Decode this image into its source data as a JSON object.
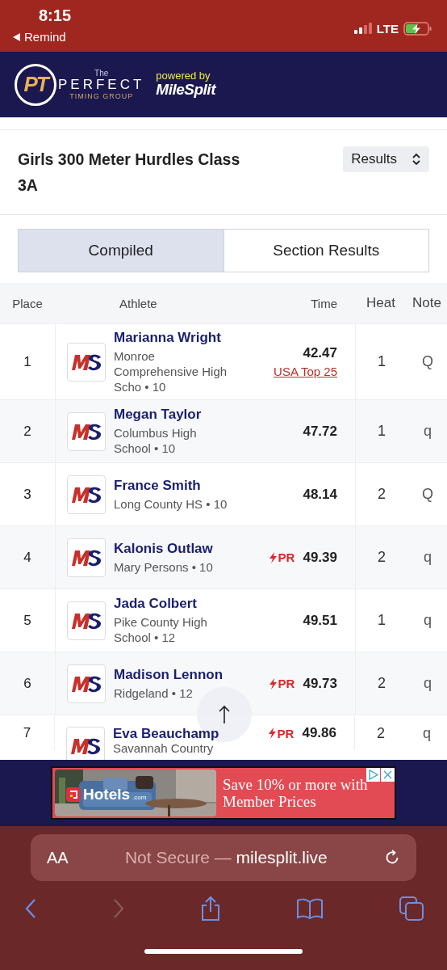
{
  "status_bar": {
    "time": "8:15",
    "back_label": "Remind",
    "network": "LTE"
  },
  "header": {
    "logo_mark": "PT",
    "logo_the": "The",
    "logo_name": "PERFECT",
    "logo_sub": "TIMING GROUP",
    "powered_by": "powered by",
    "partner": "MileSplit"
  },
  "event": {
    "title": "Girls 300 Meter Hurdles Class 3A",
    "view_select": "Results"
  },
  "tabs": [
    {
      "label": "Compiled",
      "selected": true
    },
    {
      "label": "Section Results",
      "selected": false
    }
  ],
  "table": {
    "columns": [
      "Place",
      "Athlete",
      "Time",
      "Heat",
      "Note"
    ],
    "rows": [
      {
        "place": "1",
        "name": "Marianna Wright",
        "school": "Monroe Comprehensive High Scho • 10",
        "time": "42.47",
        "badge_link": "USA Top 25",
        "heat": "1",
        "note": "Q"
      },
      {
        "place": "2",
        "name": "Megan Taylor",
        "school": "Columbus High School • 10",
        "time": "47.72",
        "heat": "1",
        "note": "q"
      },
      {
        "place": "3",
        "name": "France Smith",
        "school": "Long County HS • 10",
        "time": "48.14",
        "heat": "2",
        "note": "Q"
      },
      {
        "place": "4",
        "name": "Kalonis Outlaw",
        "school": "Mary Persons • 10",
        "pr": "PR",
        "time": "49.39",
        "heat": "2",
        "note": "q"
      },
      {
        "place": "5",
        "name": "Jada Colbert",
        "school": "Pike County High School • 12",
        "time": "49.51",
        "heat": "1",
        "note": "q"
      },
      {
        "place": "6",
        "name": "Madison Lennon",
        "school": "Ridgeland • 12",
        "pr": "PR",
        "time": "49.73",
        "heat": "2",
        "note": "q"
      },
      {
        "place": "7",
        "name": "Eva Beauchamp",
        "school": "Savannah Country",
        "pr": "PR",
        "time": "49.86",
        "heat": "2",
        "note": "q"
      }
    ]
  },
  "ad": {
    "brand": "Hotels",
    "brand_suffix": ".com",
    "headline": "Save 10% or more with Member Prices"
  },
  "browser": {
    "text_size": "AA",
    "security": "Not Secure —",
    "domain": "milesplit.live",
    "back_enabled": true,
    "forward_enabled": false
  }
}
